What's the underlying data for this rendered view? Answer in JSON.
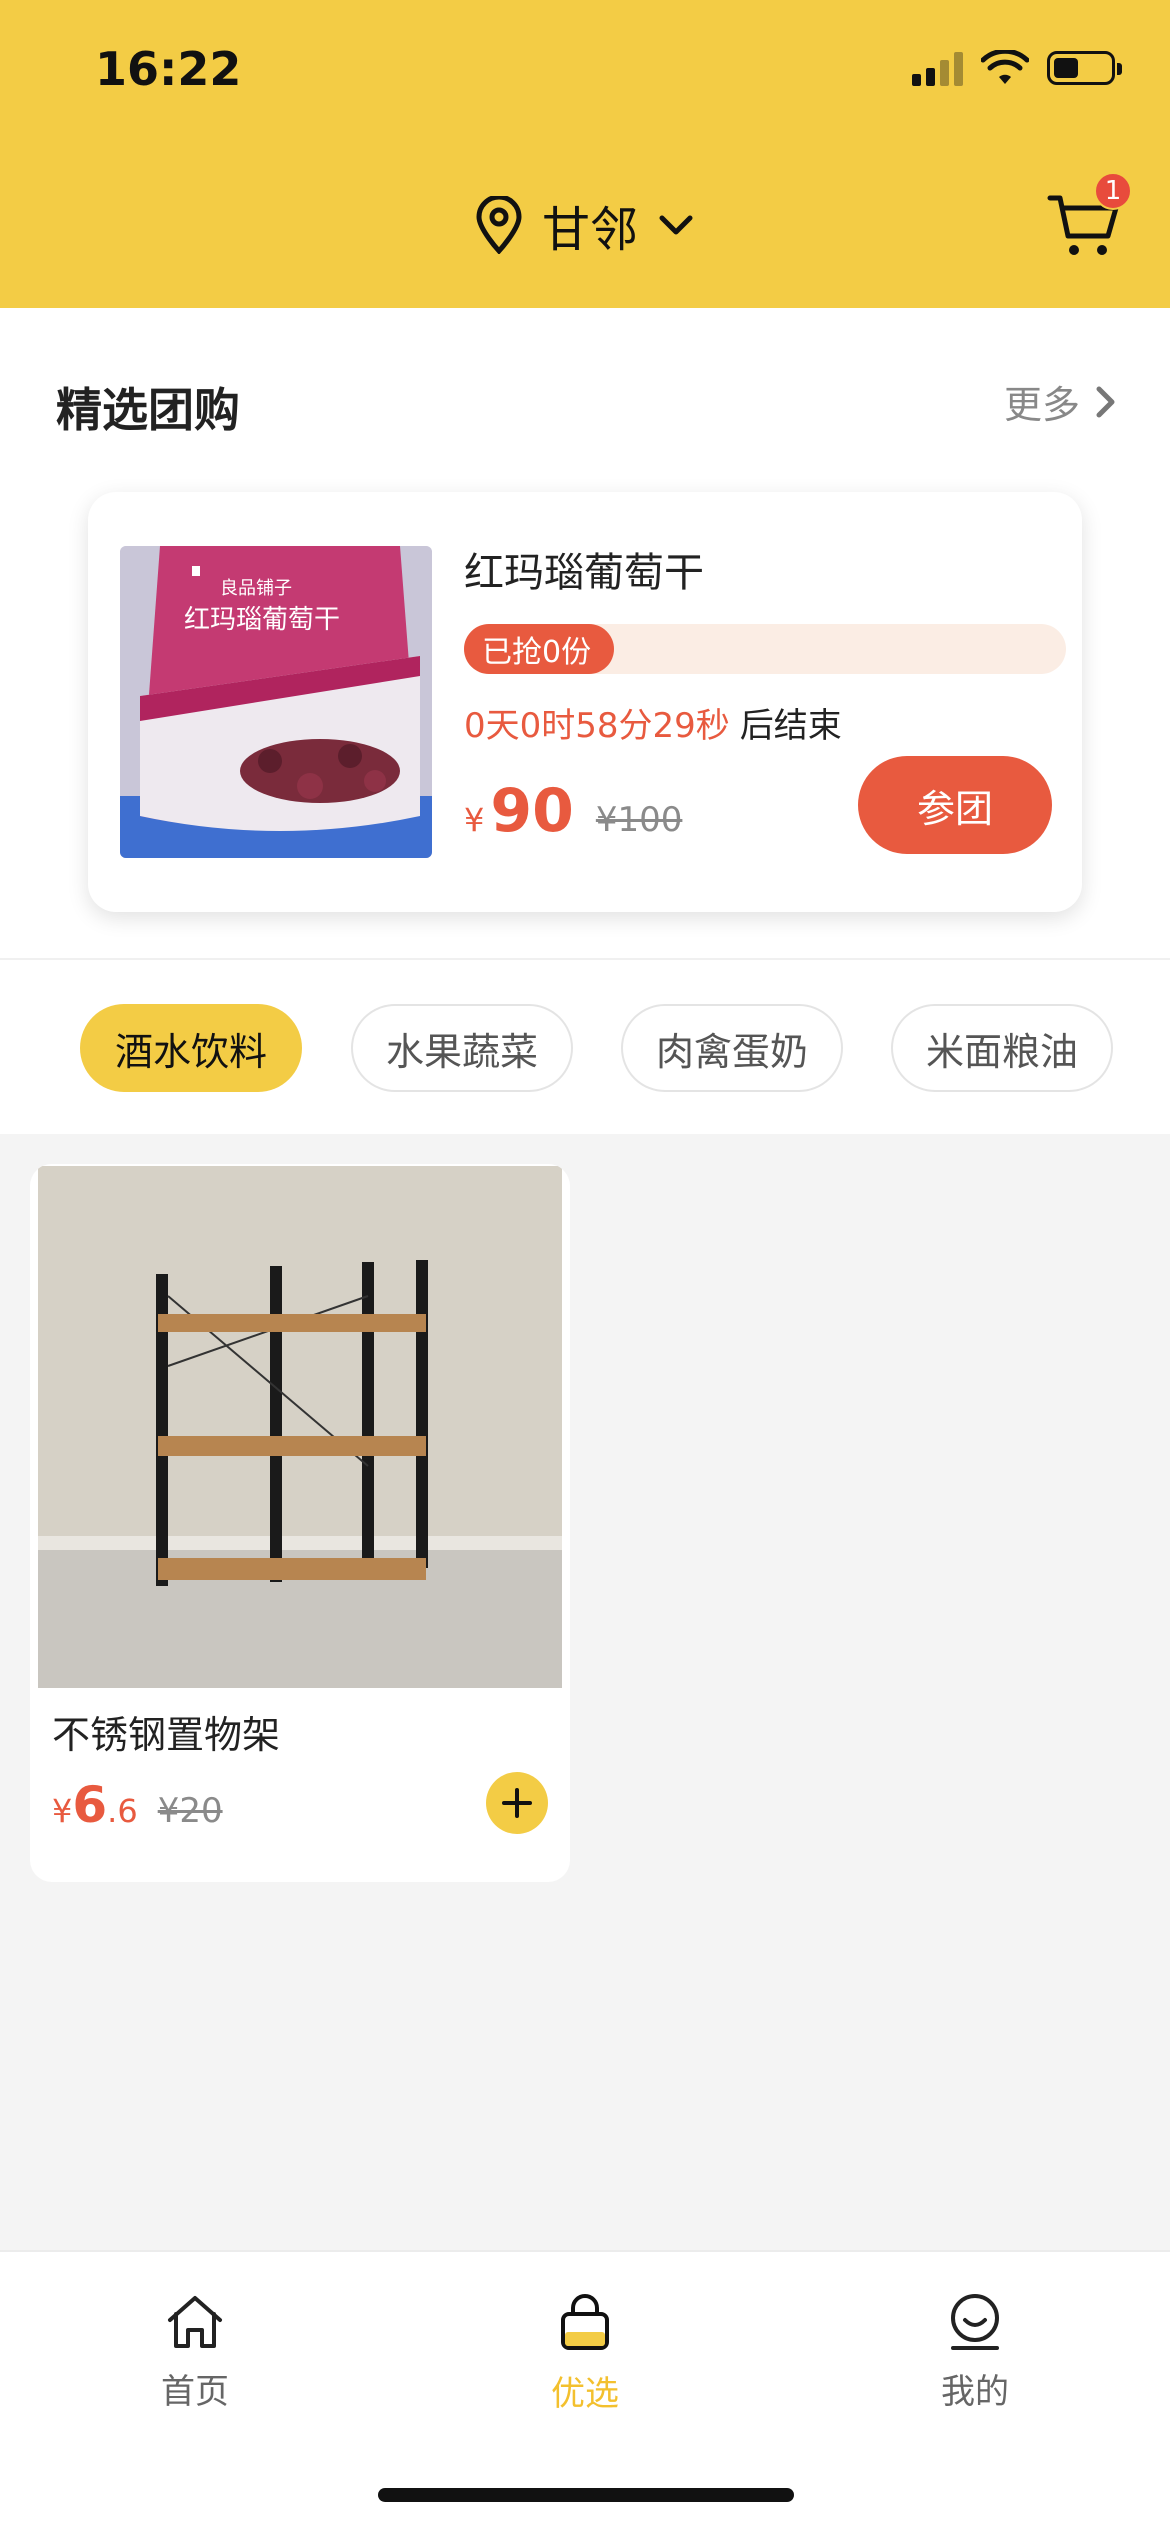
{
  "status_bar": {
    "time": "16:22"
  },
  "header": {
    "location": "甘邻",
    "cart_count": "1"
  },
  "group_buy": {
    "title": "精选团购",
    "more": "更多",
    "product": {
      "name": "红玛瑙葡萄干",
      "progress_text": "已抢0份",
      "countdown": "0天0时58分29秒",
      "countdown_suffix": "后结束",
      "currency": "¥",
      "price": "90",
      "original_price": "¥100",
      "join_label": "参团",
      "image_brand": "良品铺子",
      "image_text": "红玛瑙葡萄干"
    }
  },
  "categories": [
    "酒水饮料",
    "水果蔬菜",
    "肉禽蛋奶",
    "米面粮油"
  ],
  "products": [
    {
      "name": "不锈钢置物架",
      "currency": "¥",
      "price_int": "6",
      "price_dec": ".6",
      "original_price": "¥20"
    }
  ],
  "nav": [
    {
      "label": "首页",
      "icon": "home-icon",
      "active": false
    },
    {
      "label": "优选",
      "icon": "bag-icon",
      "active": true
    },
    {
      "label": "我的",
      "icon": "profile-icon",
      "active": false
    }
  ],
  "colors": {
    "brand": "#F3CC45",
    "accent": "#E85A3F"
  }
}
